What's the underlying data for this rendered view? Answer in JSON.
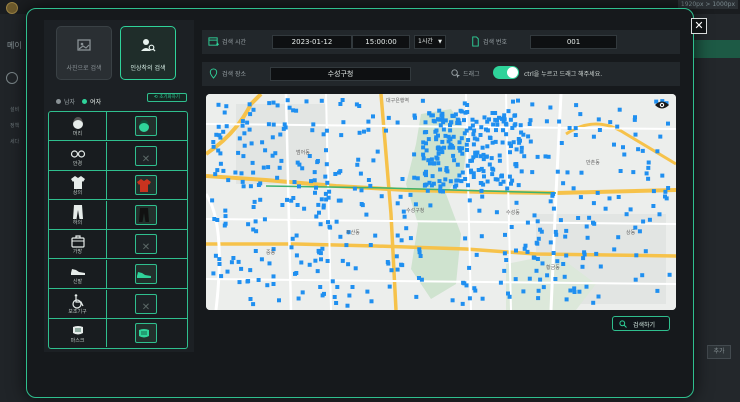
{
  "background": {
    "corner_badge": "1920px > 1000px",
    "sidebar_title": "메이",
    "side_items": [
      "설비",
      "정책",
      "세다"
    ],
    "confirm_label": "추가"
  },
  "left_panel": {
    "mode_photo_label": "사진으로 검색",
    "mode_person_label": "인상착의 검색",
    "gender_male": "남자",
    "gender_female": "여자",
    "reset_label": "초기화하기",
    "attributes": [
      {
        "label": "머리",
        "icon": "hair-icon",
        "selected": true,
        "selected_icon": "hair-icon",
        "color": "#2fd39a"
      },
      {
        "label": "안경",
        "icon": "glasses-icon",
        "selected": false
      },
      {
        "label": "상의",
        "icon": "shirt-icon",
        "selected": true,
        "selected_icon": "shirt-icon",
        "color": "#c8331f"
      },
      {
        "label": "하의",
        "icon": "pants-icon",
        "selected": true,
        "selected_icon": "pants-icon",
        "color": "#111111"
      },
      {
        "label": "가방",
        "icon": "bag-icon",
        "selected": false
      },
      {
        "label": "신발",
        "icon": "shoes-icon",
        "selected": true,
        "selected_icon": "shoes-icon",
        "color": "#2fd39a"
      },
      {
        "label": "보조기구",
        "icon": "wheelchair-icon",
        "selected": false
      },
      {
        "label": "마스크",
        "icon": "mask-icon",
        "selected": true,
        "selected_icon": "mask-icon",
        "color": "#2fd39a"
      }
    ]
  },
  "search_bar": {
    "time_label": "검색 시간",
    "date": "2023-01-12",
    "time": "15:00:00",
    "range": "1시간",
    "camera_label": "검색 번호",
    "camera_value": "001",
    "area_label": "검색 장소",
    "area_value": "수성구청",
    "drag_label": "드래그",
    "drag_enabled": true,
    "hint": "ctrl을 누르고 드래그 해주세요."
  },
  "map": {
    "marker_color": "#1f8ff0",
    "labels": [
      "수성구청",
      "범어동",
      "만촌동",
      "대구은행역",
      "두산동",
      "상동",
      "황금동",
      "중동",
      "수성동"
    ]
  },
  "search_button_label": "검색하기",
  "colors": {
    "accent": "#2fd39a",
    "border": "#2fbf8e",
    "panel": "#16191c"
  }
}
